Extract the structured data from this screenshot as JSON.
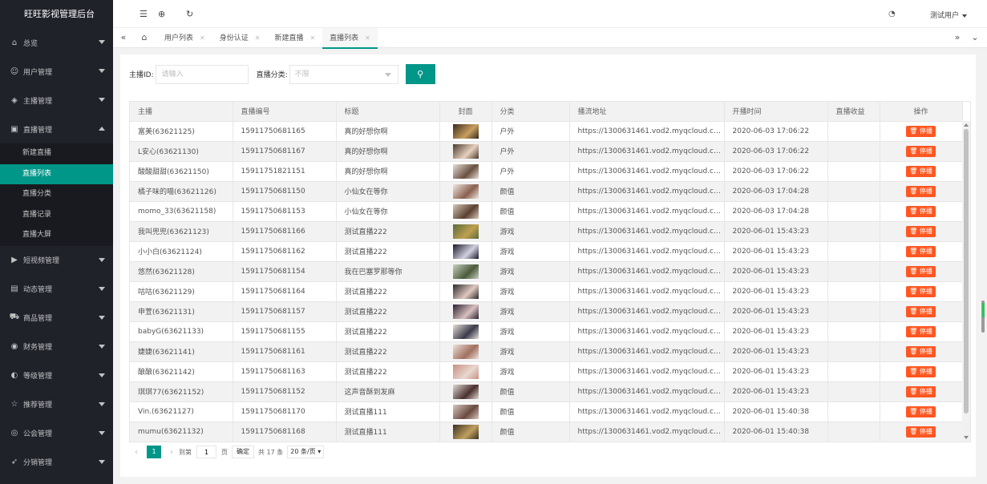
{
  "app": {
    "title": "旺旺影视管理后台"
  },
  "sidebar": {
    "items": [
      {
        "label": "总览",
        "icon": "home-icon"
      },
      {
        "label": "用户管理",
        "icon": "users-icon"
      },
      {
        "label": "主播管理",
        "icon": "shield-icon"
      },
      {
        "label": "直播管理",
        "icon": "screen-icon",
        "expanded": true,
        "children": [
          {
            "label": "新建直播"
          },
          {
            "label": "直播列表",
            "active": true
          },
          {
            "label": "直播分类"
          },
          {
            "label": "直播记录"
          },
          {
            "label": "直播大屏"
          }
        ]
      },
      {
        "label": "短视频管理",
        "icon": "play-icon"
      },
      {
        "label": "动态管理",
        "icon": "picture-icon"
      },
      {
        "label": "商品管理",
        "icon": "cart-icon"
      },
      {
        "label": "财务管理",
        "icon": "money-icon"
      },
      {
        "label": "等级管理",
        "icon": "level-icon"
      },
      {
        "label": "推荐管理",
        "icon": "star-icon"
      },
      {
        "label": "公会管理",
        "icon": "guild-icon"
      },
      {
        "label": "分销管理",
        "icon": "share-icon"
      }
    ]
  },
  "header": {
    "user": "测试用户",
    "icons": [
      "menu-fold-icon",
      "globe-icon",
      "refresh-icon",
      "theme-icon"
    ]
  },
  "tabs": [
    {
      "label": "用户列表"
    },
    {
      "label": "身份认证"
    },
    {
      "label": "新建直播"
    },
    {
      "label": "直播列表",
      "active": true
    }
  ],
  "filter": {
    "anchor_label": "主播ID:",
    "anchor_placeholder": "请输入",
    "category_label": "直播分类:",
    "category_value": "不限"
  },
  "table": {
    "columns": [
      "主播",
      "直播编号",
      "标题",
      "封面",
      "分类",
      "播流地址",
      "开播时间",
      "直播收益",
      "操作"
    ],
    "action_label": "停播",
    "rows": [
      {
        "anchor": "富美(63621125)",
        "no": "15911750681165",
        "title": "真的好想你啊",
        "cover": [
          "#3a2a1a",
          "#c8a060"
        ],
        "cat": "户外",
        "url": "https://1300631461.vod2.myqcloud.com/9...",
        "time": "2020-06-03 17:06:22",
        "income": ""
      },
      {
        "anchor": "L安心(63621130)",
        "no": "15911750681167",
        "title": "真的好想你啊",
        "cover": [
          "#4a3a2a",
          "#e8d0c0"
        ],
        "cat": "户外",
        "url": "https://1300631461.vod2.myqcloud.com/9...",
        "time": "2020-06-03 17:06:22",
        "income": ""
      },
      {
        "anchor": "酸酸甜甜(63621150)",
        "no": "15911751821151",
        "title": "真的好想你啊",
        "cover": [
          "#e8e0d8",
          "#6a5040"
        ],
        "cat": "户外",
        "url": "https://1300631461.vod2.myqcloud.com/9...",
        "time": "2020-06-03 17:06:22",
        "income": ""
      },
      {
        "anchor": "橘子味的喵(63621126)",
        "no": "15911750681150",
        "title": "小仙女在等你",
        "cover": [
          "#f0e8e0",
          "#8a6050"
        ],
        "cat": "颜值",
        "url": "https://1300631461.vod2.myqcloud.com/9...",
        "time": "2020-06-03 17:04:28",
        "income": ""
      },
      {
        "anchor": "momo_33(63621158)",
        "no": "15911750681153",
        "title": "小仙女在等你",
        "cover": [
          "#d8c8b8",
          "#5a4030"
        ],
        "cat": "颜值",
        "url": "https://1300631461.vod2.myqcloud.com/9...",
        "time": "2020-06-03 17:04:28",
        "income": ""
      },
      {
        "anchor": "我叫兜兜(63621123)",
        "no": "15911750681166",
        "title": "测试直播222",
        "cover": [
          "#5a6a3a",
          "#c0a050"
        ],
        "cat": "游戏",
        "url": "https://1300631461.vod2.myqcloud.com/9...",
        "time": "2020-06-01 15:43:23",
        "income": ""
      },
      {
        "anchor": "小小白(63621124)",
        "no": "15911750681162",
        "title": "测试直播222",
        "cover": [
          "#1a1a2a",
          "#d0d0e0"
        ],
        "cat": "游戏",
        "url": "https://1300631461.vod2.myqcloud.com/9...",
        "time": "2020-06-01 15:43:23",
        "income": ""
      },
      {
        "anchor": "悠然(63621128)",
        "no": "15911750681154",
        "title": "我在巴塞罗那等你",
        "cover": [
          "#c8d0c0",
          "#4a5a3a"
        ],
        "cat": "游戏",
        "url": "https://1300631461.vod2.myqcloud.com/9...",
        "time": "2020-06-01 15:43:23",
        "income": ""
      },
      {
        "anchor": "咕咕(63621129)",
        "no": "15911750681164",
        "title": "测试直播222",
        "cover": [
          "#2a2a2a",
          "#e0c8c0"
        ],
        "cat": "游戏",
        "url": "https://1300631461.vod2.myqcloud.com/9...",
        "time": "2020-06-01 15:43:23",
        "income": ""
      },
      {
        "anchor": "申萱(63621131)",
        "no": "15911750681157",
        "title": "测试直播222",
        "cover": [
          "#2a2030",
          "#d8c0c0"
        ],
        "cat": "游戏",
        "url": "https://1300631461.vod2.myqcloud.com/9...",
        "time": "2020-06-01 15:43:23",
        "income": ""
      },
      {
        "anchor": "babyG(63621133)",
        "no": "15911750681155",
        "title": "测试直播222",
        "cover": [
          "#e8e0d8",
          "#3a3a4a"
        ],
        "cat": "游戏",
        "url": "https://1300631461.vod2.myqcloud.com/9...",
        "time": "2020-06-01 15:43:23",
        "income": ""
      },
      {
        "anchor": "婕婕(63621141)",
        "no": "15911750681161",
        "title": "测试直播222",
        "cover": [
          "#f0e0d8",
          "#a07060"
        ],
        "cat": "游戏",
        "url": "https://1300631461.vod2.myqcloud.com/9...",
        "time": "2020-06-01 15:43:23",
        "income": ""
      },
      {
        "anchor": "酿酿(63621142)",
        "no": "15911750681163",
        "title": "测试直播222",
        "cover": [
          "#c89080",
          "#e8d8d0"
        ],
        "cat": "游戏",
        "url": "https://1300631461.vod2.myqcloud.com/9...",
        "time": "2020-06-01 15:43:23",
        "income": ""
      },
      {
        "anchor": "琪琪77(63621152)",
        "no": "15911750681152",
        "title": "这声音酥到发麻",
        "cover": [
          "#e0d8d0",
          "#4a3030"
        ],
        "cat": "颜值",
        "url": "https://1300631461.vod2.myqcloud.com/9...",
        "time": "2020-06-01 15:43:23",
        "income": ""
      },
      {
        "anchor": "Vin.(63621127)",
        "no": "15911750681170",
        "title": "测试直播111",
        "cover": [
          "#d8c8c0",
          "#6a4a40"
        ],
        "cat": "颜值",
        "url": "https://1300631461.vod2.myqcloud.com/9...",
        "time": "2020-06-01 15:40:38",
        "income": ""
      },
      {
        "anchor": "mumu(63621132)",
        "no": "15911750681168",
        "title": "测试直播111",
        "cover": [
          "#3a3020",
          "#c0a060"
        ],
        "cat": "颜值",
        "url": "https://1300631461.vod2.myqcloud.com/9...",
        "time": "2020-06-01 15:40:38",
        "income": ""
      }
    ]
  },
  "pager": {
    "current": "1",
    "goto_label": "到第",
    "page_input": "1",
    "page_unit": "页",
    "confirm": "确定",
    "total": "共 17 条",
    "page_size": "20 条/页"
  },
  "colors": {
    "accent": "#009688",
    "danger": "#ff5722",
    "sidebar_bg": "#20222a"
  }
}
